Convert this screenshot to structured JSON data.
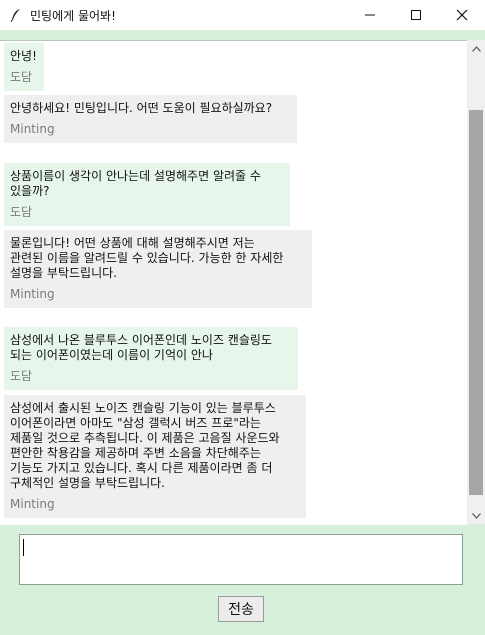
{
  "window": {
    "title": "민팅에게 물어봐!",
    "app_icon": "feather-icon",
    "controls": [
      "minimize-icon",
      "maximize-icon",
      "close-icon"
    ]
  },
  "messages": [
    {
      "role": "user",
      "text": "안녕!",
      "sender": "도담"
    },
    {
      "role": "bot",
      "text": "안녕하세요! 민팅입니다. 어떤 도움이 필요하실까요?",
      "sender": "Minting"
    },
    {
      "role": "user",
      "text": "상품이름이 생각이 안나는데 설명해주면 알려줄 수\n있을까?",
      "sender": "도담"
    },
    {
      "role": "bot",
      "text": "물론입니다! 어떤 상품에 대해 설명해주시면 저는\n관련된 이름을 알려드릴 수 있습니다. 가능한 한 자세한\n설명을 부탁드립니다.",
      "sender": "Minting"
    },
    {
      "role": "user",
      "text": "삼성에서 나온 블루투스 이어폰인데 노이즈 캔슬링도\n되는 이어폰이였는데 이름이 기억이 안나",
      "sender": "도담"
    },
    {
      "role": "bot",
      "text": "삼성에서 출시된 노이즈 캔슬링 기능이 있는 블루투스\n이어폰이라면 아마도 \"삼성 갤럭시 버즈 프로\"라는\n제품일 것으로 추측됩니다. 이 제품은 고음질 사운드와\n편안한 착용감을 제공하며 주변 소음을 차단해주는\n기능도 가지고 있습니다. 혹시 다른 제품이라면 좀 더\n구체적인 설명을 부탁드립니다.",
      "sender": "Minting"
    }
  ],
  "input": {
    "value": ""
  },
  "send_button": {
    "label": "전송"
  },
  "colors": {
    "background": "#d6f0dc",
    "user_bubble": "#e7f6ea",
    "bot_bubble": "#efefef",
    "sender_text": "#7a7a7a"
  }
}
